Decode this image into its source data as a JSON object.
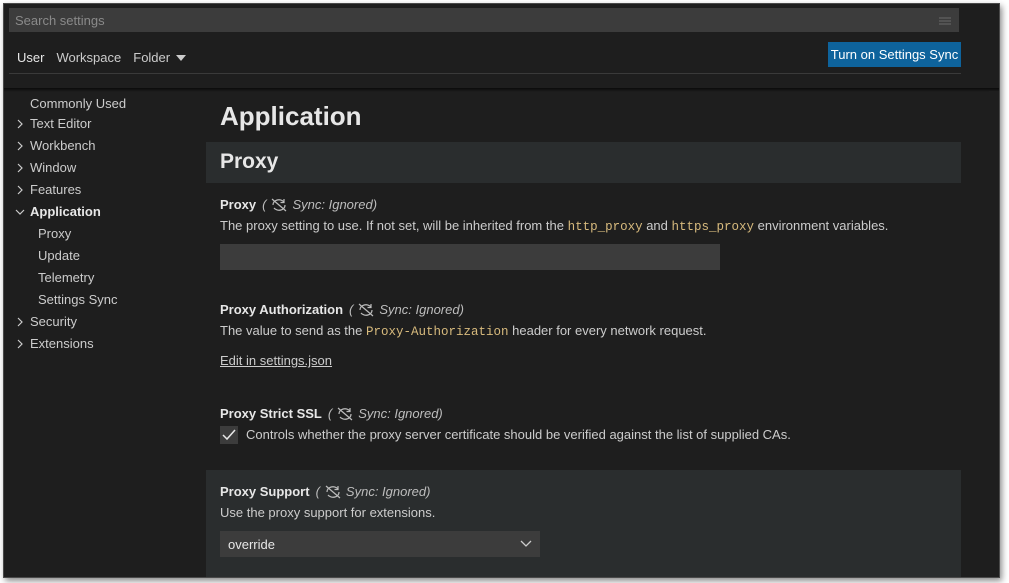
{
  "search": {
    "placeholder": "Search settings"
  },
  "tabs": [
    {
      "label": "User"
    },
    {
      "label": "Workspace"
    },
    {
      "label": "Folder"
    }
  ],
  "sync_button": {
    "label": "Turn on Settings Sync"
  },
  "toc": {
    "items": [
      {
        "label": "Commonly Used"
      },
      {
        "label": "Text Editor"
      },
      {
        "label": "Workbench"
      },
      {
        "label": "Window"
      },
      {
        "label": "Features"
      },
      {
        "label": "Application"
      },
      {
        "label": "Proxy"
      },
      {
        "label": "Update"
      },
      {
        "label": "Telemetry"
      },
      {
        "label": "Settings Sync"
      },
      {
        "label": "Security"
      },
      {
        "label": "Extensions"
      }
    ]
  },
  "content": {
    "page_title": "Application",
    "section_title": "Proxy",
    "sync_ignored": "(Sync: Ignored)",
    "proxy": {
      "name": "Proxy",
      "desc_pre": "The proxy setting to use. If not set, will be inherited from the ",
      "code1": "http_proxy",
      "desc_mid": " and ",
      "code2": "https_proxy",
      "desc_post": " environment variables.",
      "value": ""
    },
    "proxy_auth": {
      "name": "Proxy Authorization",
      "desc_pre": "The value to send as the ",
      "code": "Proxy-Authorization",
      "desc_post": " header for every network request.",
      "link": "Edit in settings.json"
    },
    "strict_ssl": {
      "name": "Proxy Strict SSL",
      "desc": "Controls whether the proxy server certificate should be verified against the list of supplied CAs."
    },
    "support": {
      "name": "Proxy Support",
      "desc": "Use the proxy support for extensions.",
      "selected": "override"
    }
  },
  "colors": {
    "background": "#1e1e1e",
    "input": "#3c3c3c",
    "accent_button": "#0e639c",
    "code": "#d7ba7d",
    "band": "#2a2d2e"
  },
  "icons": {
    "filter": "filter-icon",
    "chevron_right": "chevron-right-icon",
    "chevron_down": "chevron-down-icon",
    "sync_ignored": "sync-ignored-icon",
    "check": "check-icon"
  }
}
